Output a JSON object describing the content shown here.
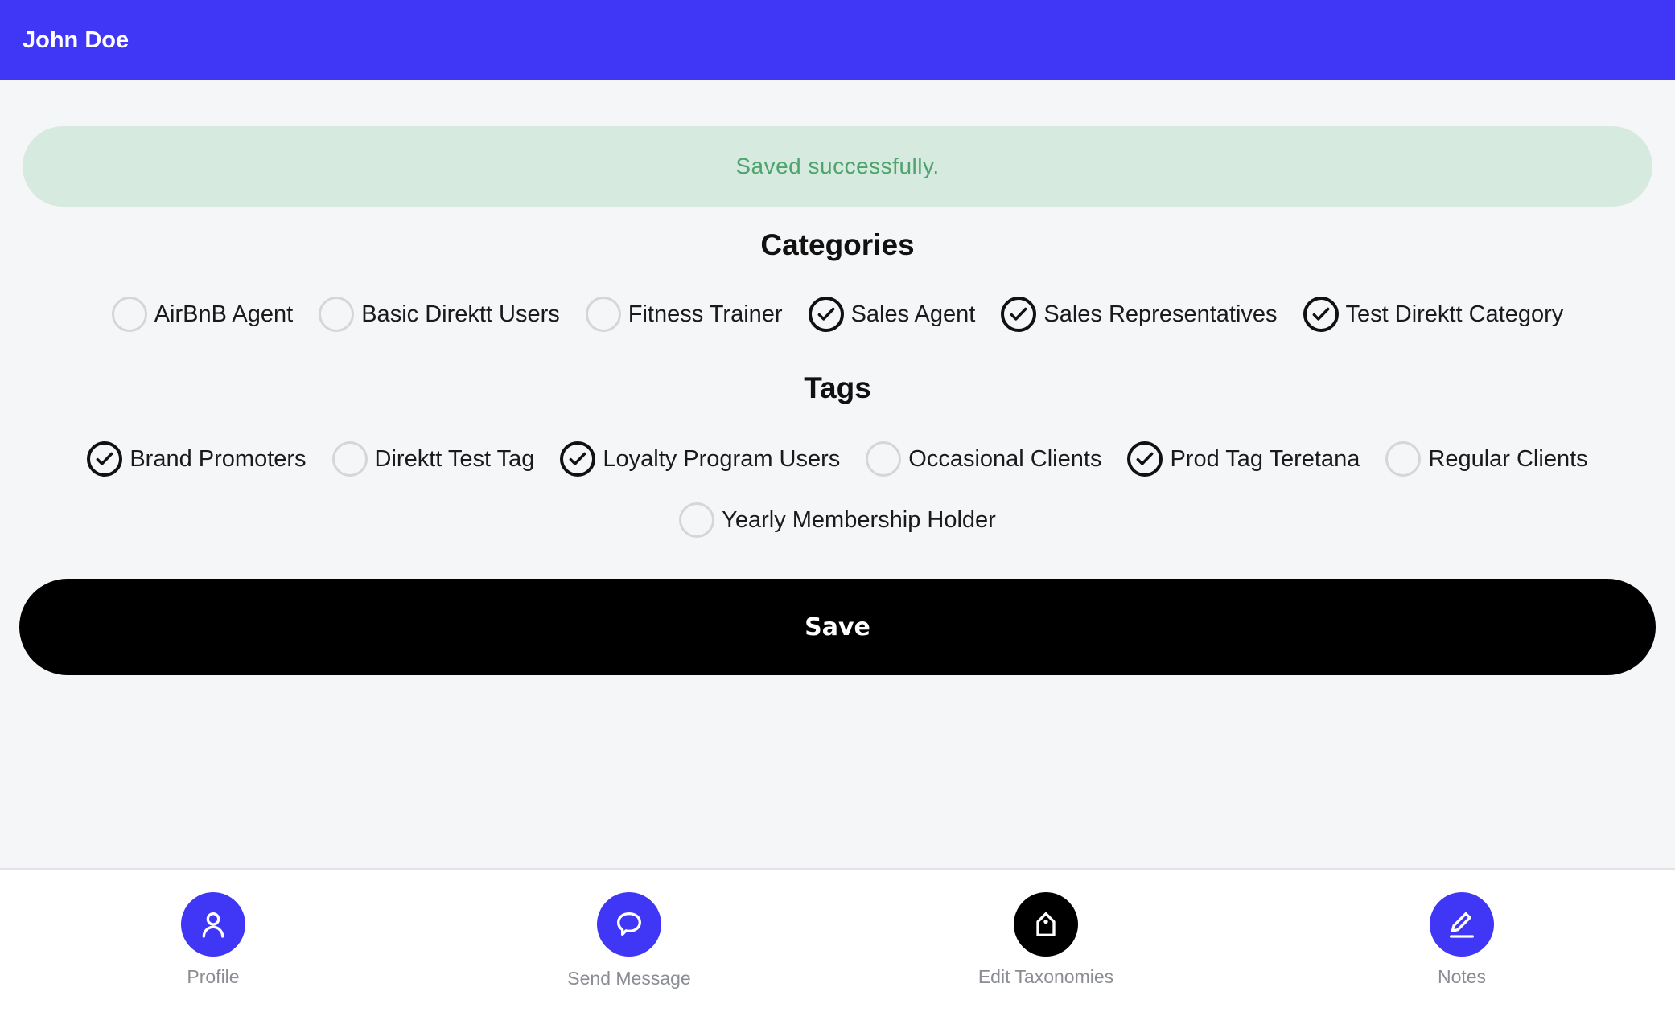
{
  "header": {
    "title": "John Doe"
  },
  "alert": {
    "message": "Saved successfully."
  },
  "categories": {
    "title": "Categories",
    "items": [
      {
        "label": "AirBnB Agent",
        "checked": false
      },
      {
        "label": "Basic Direktt Users",
        "checked": false
      },
      {
        "label": "Fitness Trainer",
        "checked": false
      },
      {
        "label": "Sales Agent",
        "checked": true
      },
      {
        "label": "Sales Representatives",
        "checked": true
      },
      {
        "label": "Test Direktt Category",
        "checked": true
      }
    ]
  },
  "tags": {
    "title": "Tags",
    "items": [
      {
        "label": "Brand Promoters",
        "checked": true
      },
      {
        "label": "Direktt Test Tag",
        "checked": false
      },
      {
        "label": "Loyalty Program Users",
        "checked": true
      },
      {
        "label": "Occasional Clients",
        "checked": false
      },
      {
        "label": "Prod Tag Teretana",
        "checked": true
      },
      {
        "label": "Regular Clients",
        "checked": false
      },
      {
        "label": "Yearly Membership Holder",
        "checked": false
      }
    ]
  },
  "save": {
    "label": "Save"
  },
  "bottom_nav": [
    {
      "label": "Profile",
      "icon": "user-icon",
      "active": false
    },
    {
      "label": "Send Message",
      "icon": "chat-bubble-icon",
      "active": false
    },
    {
      "label": "Edit Taxonomies",
      "icon": "tag-icon",
      "active": true
    },
    {
      "label": "Notes",
      "icon": "pencil-icon",
      "active": false
    }
  ],
  "colors": {
    "primary": "#4036f5",
    "alert_bg": "#d7eadf",
    "alert_text": "#4fa36d",
    "button": "#000000"
  }
}
